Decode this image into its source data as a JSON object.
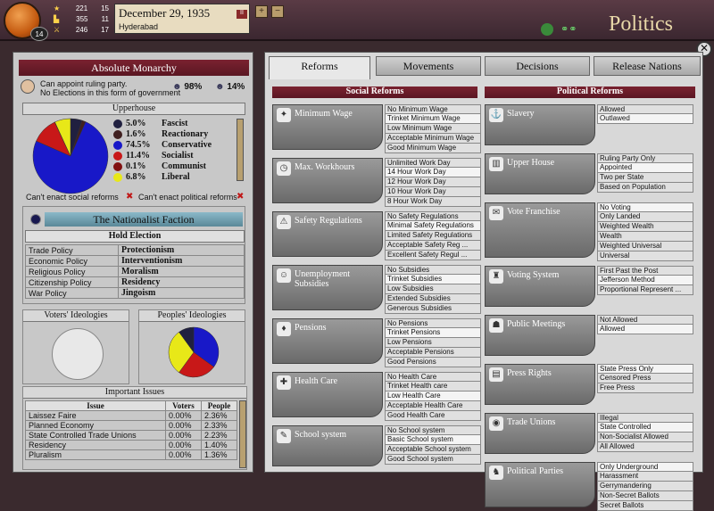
{
  "topbar": {
    "stats": [
      {
        "v": "221",
        "n": "15"
      },
      {
        "v": "355",
        "n": "11"
      },
      {
        "v": "246",
        "n": "17"
      }
    ],
    "rank": "14",
    "date": "December 29, 1935",
    "province": "Hyderabad",
    "title": "Politics"
  },
  "government": {
    "name": "Absolute Monarchy",
    "line1": "Can appoint ruling party.",
    "line2": "No Elections in this form of government",
    "pct1": "98%",
    "pct2": "14%"
  },
  "upperhouse": {
    "title": "Upperhouse",
    "rows": [
      {
        "pct": "5.0%",
        "name": "Fascist",
        "color": "#202040"
      },
      {
        "pct": "1.6%",
        "name": "Reactionary",
        "color": "#402020"
      },
      {
        "pct": "74.5%",
        "name": "Conservative",
        "color": "#1818c8"
      },
      {
        "pct": "11.4%",
        "name": "Socialist",
        "color": "#c81818"
      },
      {
        "pct": "0.1%",
        "name": "Communist",
        "color": "#801010"
      },
      {
        "pct": "6.8%",
        "name": "Liberal",
        "color": "#e8e818"
      }
    ],
    "no_social": "Can't enact social reforms",
    "no_political": "Can't enact political reforms"
  },
  "chart_data": [
    {
      "type": "pie",
      "title": "Upperhouse",
      "categories": [
        "Fascist",
        "Reactionary",
        "Conservative",
        "Socialist",
        "Communist",
        "Liberal"
      ],
      "values": [
        5.0,
        1.6,
        74.5,
        11.4,
        0.1,
        6.8
      ]
    },
    {
      "type": "pie",
      "title": "Peoples' Ideologies"
    }
  ],
  "party": {
    "name": "The Nationalist Faction",
    "hold_election": "Hold Election",
    "policies": [
      {
        "k": "Trade Policy",
        "v": "Protectionism"
      },
      {
        "k": "Economic Policy",
        "v": "Interventionism"
      },
      {
        "k": "Religious Policy",
        "v": "Moralism"
      },
      {
        "k": "Citizenship Policy",
        "v": "Residency"
      },
      {
        "k": "War Policy",
        "v": "Jingoism"
      }
    ]
  },
  "ideologies": {
    "voters": "Voters' Ideologies",
    "peoples": "Peoples' Ideologies"
  },
  "issues": {
    "title": "Important Issues",
    "headers": [
      "Issue",
      "Voters",
      "People"
    ],
    "rows": [
      [
        "Laissez Faire",
        "0.00%",
        "2.36%"
      ],
      [
        "Planned Economy",
        "0.00%",
        "2.33%"
      ],
      [
        "State Controlled Trade Unions",
        "0.00%",
        "2.23%"
      ],
      [
        "Residency",
        "0.00%",
        "1.40%"
      ],
      [
        "Pluralism",
        "0.00%",
        "1.36%"
      ]
    ]
  },
  "tabs": [
    "Reforms",
    "Movements",
    "Decisions",
    "Release Nations"
  ],
  "social": {
    "title": "Social Reforms",
    "cats": [
      {
        "name": "Minimum Wage",
        "icon": "lightbulb-icon",
        "glyph": "✦",
        "opts": [
          "No Minimum Wage",
          "Trinket Minimum Wage",
          "Low Minimum Wage",
          "Acceptable Minimum Wage",
          "Good Minimum Wage"
        ],
        "sel": 1
      },
      {
        "name": "Max. Workhours",
        "icon": "clock-icon",
        "glyph": "◷",
        "opts": [
          "Unlimited Work Day",
          "14 Hour Work Day",
          "12 Hour Work Day",
          "10 Hour Work Day",
          "8 Hour Work Day"
        ],
        "sel": 1
      },
      {
        "name": "Safety Regulations",
        "icon": "warning-icon",
        "glyph": "⚠",
        "opts": [
          "No Safety Regulations",
          "Minimal Safety Regulations",
          "Limited Safety Regulations",
          "Acceptable Safety Reg ...",
          "Excellent Safety Regul ..."
        ],
        "sel": 1
      },
      {
        "name": "Unemployment Subsidies",
        "icon": "people-icon",
        "glyph": "☺",
        "opts": [
          "No Subsidies",
          "Trinket Subsidies",
          "Low Subsidies",
          "Extended Subsidies",
          "Generous Subsidies"
        ],
        "sel": 1
      },
      {
        "name": "Pensions",
        "icon": "pension-icon",
        "glyph": "♦",
        "opts": [
          "No Pensions",
          "Trinket Pensions",
          "Low Pensions",
          "Acceptable Pensions",
          "Good Pensions"
        ],
        "sel": 1
      },
      {
        "name": "Health Care",
        "icon": "medical-icon",
        "glyph": "✚",
        "opts": [
          "No Health Care",
          "Trinket Health care",
          "Low Health Care",
          "Acceptable Health Care",
          "Good Health Care"
        ],
        "sel": 2
      },
      {
        "name": "School system",
        "icon": "school-icon",
        "glyph": "✎",
        "opts": [
          "No School system",
          "Basic School system",
          "Acceptable School system",
          "Good School system"
        ],
        "sel": 1
      }
    ]
  },
  "political": {
    "title": "Political Reforms",
    "cats": [
      {
        "name": "Slavery",
        "icon": "chain-icon",
        "glyph": "⚓",
        "opts": [
          "Allowed",
          "Outlawed"
        ],
        "sel": 1
      },
      {
        "name": "Upper House",
        "icon": "building-icon",
        "glyph": "▥",
        "opts": [
          "Ruling Party Only",
          "Appointed",
          "Two per State",
          "Based on Population"
        ],
        "sel": 1
      },
      {
        "name": "Vote Franchise",
        "icon": "ballot-icon",
        "glyph": "✉",
        "opts": [
          "No Voting",
          "Only Landed",
          "Weighted Wealth",
          "Wealth",
          "Weighted Universal",
          "Universal"
        ],
        "sel": 0
      },
      {
        "name": "Voting System",
        "icon": "chair-icon",
        "glyph": "♜",
        "opts": [
          "First Past the Post",
          "Jefferson Method",
          "Proportional Represent ..."
        ],
        "sel": 1
      },
      {
        "name": "Public Meetings",
        "icon": "meeting-icon",
        "glyph": "☗",
        "opts": [
          "Not Allowed",
          "Allowed"
        ],
        "sel": 1
      },
      {
        "name": "Press Rights",
        "icon": "press-icon",
        "glyph": "▤",
        "opts": [
          "State Press Only",
          "Censored Press",
          "Free Press"
        ],
        "sel": 0
      },
      {
        "name": "Trade Unions",
        "icon": "union-icon",
        "glyph": "◉",
        "opts": [
          "Illegal",
          "State Controlled",
          "Non-Socialist Allowed",
          "All Allowed"
        ],
        "sel": 1
      },
      {
        "name": "Political Parties",
        "icon": "party-icon",
        "glyph": "♞",
        "opts": [
          "Only Underground",
          "Harassment",
          "Gerrymandering",
          "Non-Secret Ballots",
          "Secret Ballots"
        ],
        "sel": 0
      }
    ]
  }
}
